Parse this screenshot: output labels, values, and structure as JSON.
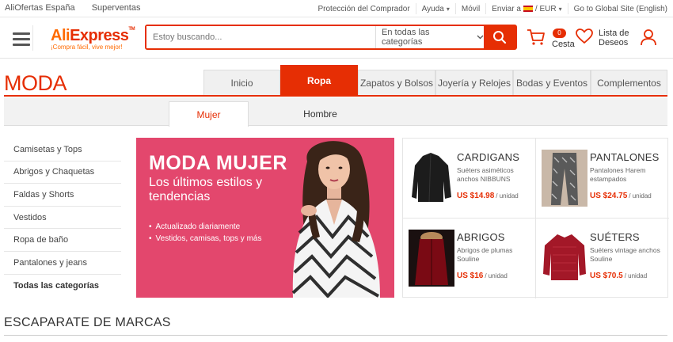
{
  "topbar": {
    "left_links": [
      "AliOfertas España",
      "Superventas"
    ],
    "buyer_protection": "Protección del Comprador",
    "help": "Ayuda",
    "mobile": "Móvil",
    "ship_to": "Enviar a",
    "currency": "EUR",
    "global_site": "Go to Global Site (English)"
  },
  "header": {
    "logo_ali": "Ali",
    "logo_express": "Express",
    "logo_tagline": "¡Compra fácil, vive mejor!",
    "search_placeholder": "Estoy buscando...",
    "search_category": "En todas las categorías",
    "cart_count": "0",
    "cart_label": "Cesta",
    "wishlist_label": "Lista de Deseos"
  },
  "catnav": {
    "title": "MODA",
    "tabs": [
      "Inicio",
      "Ropa",
      "Zapatos y Bolsos",
      "Joyería y Relojes",
      "Bodas y Eventos",
      "Complementos"
    ],
    "active_tab": "Ropa"
  },
  "subtabs": {
    "active": "Mujer",
    "other": "Hombre"
  },
  "sidebar": {
    "items": [
      "Camisetas y Tops",
      "Abrigos y Chaquetas",
      "Faldas y Shorts",
      "Vestidos",
      "Ropa de baño",
      "Pantalones y jeans",
      "Todas las categorías"
    ]
  },
  "banner": {
    "title": "MODA MUJER",
    "subtitle": "Los últimos estilos y tendencias",
    "bullets": [
      "Actualizado diariamente",
      "Vestidos, camisas, tops y más"
    ]
  },
  "products": [
    {
      "name": "CARDIGANS",
      "desc": "Suéters asiméticos anchos NIBBUNS",
      "price": "US $14.98",
      "unit": "/ unidad"
    },
    {
      "name": "PANTALONES",
      "desc": "Pantalones Harem estampados",
      "price": "US $24.75",
      "unit": "/ unidad"
    },
    {
      "name": "ABRIGOS",
      "desc": "Abrigos de plumas Souline",
      "price": "US $16",
      "unit": "/ unidad"
    },
    {
      "name": "SUÉTERS",
      "desc": "Suéters vintage anchos Souline",
      "price": "US $70.5",
      "unit": "/ unidad"
    }
  ],
  "brands_heading": "ESCAPARATE DE MARCAS",
  "colors": {
    "accent": "#e62e04",
    "banner": "#e3476d",
    "logo_orange": "#ff6a00"
  }
}
